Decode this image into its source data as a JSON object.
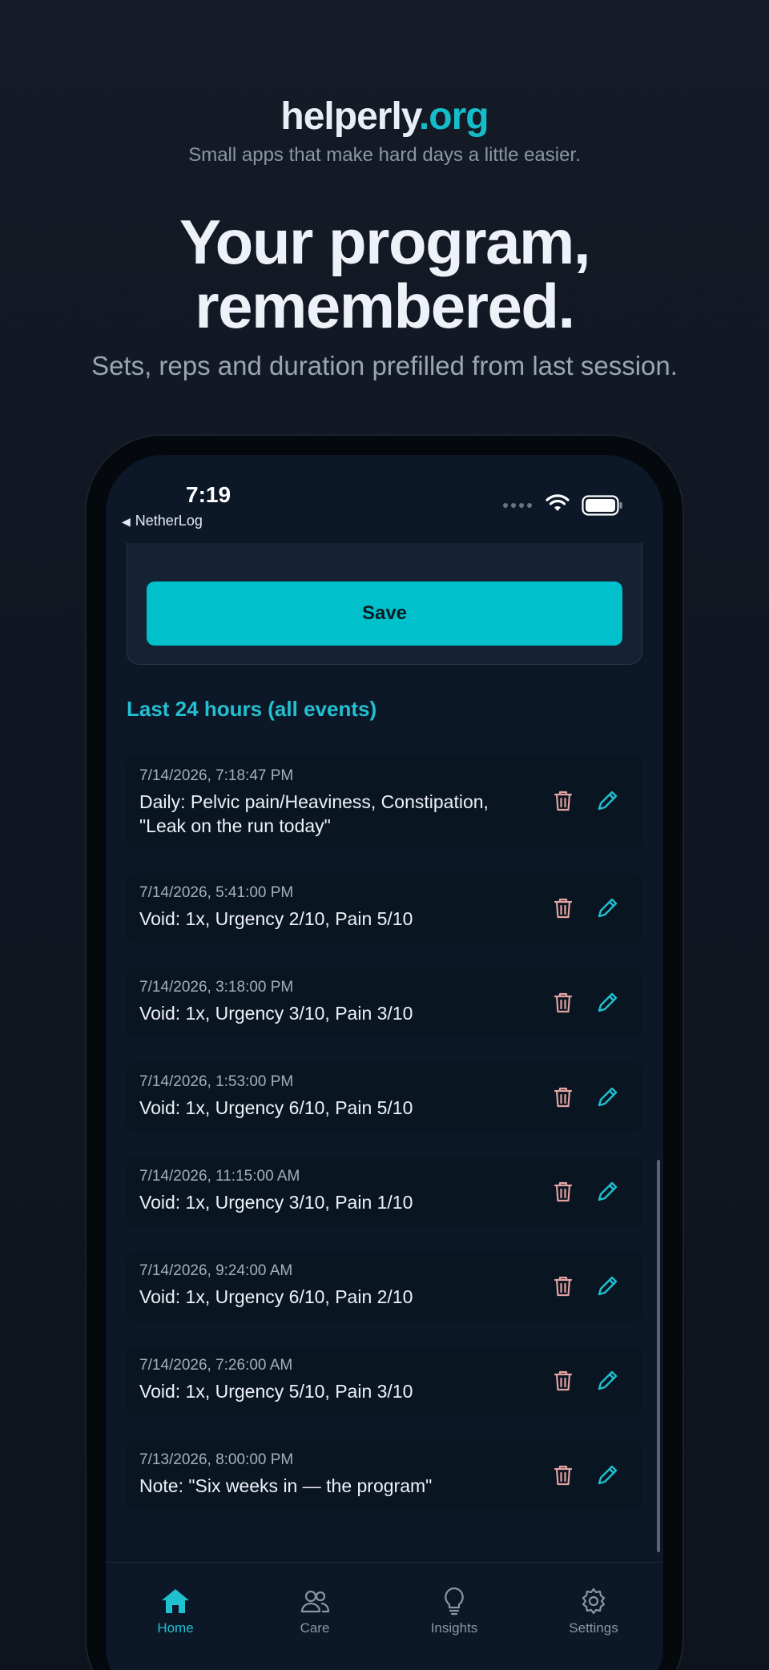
{
  "header": {
    "brand_name": "helperly",
    "brand_tld": ".org",
    "tagline": "Small apps that make hard days a little easier.",
    "hero_line1": "Your program,",
    "hero_line2": "remembered.",
    "subheading": "Sets, reps and duration prefilled from last session."
  },
  "status_bar": {
    "time": "7:19",
    "back_label": "NetherLog"
  },
  "form": {
    "save_label": "Save"
  },
  "log": {
    "section_title": "Last 24 hours (all events)",
    "entries": [
      {
        "timestamp": "7/14/2026, 7:18:47 PM",
        "text": "Daily: Pelvic pain/Heaviness, Constipation, \"Leak on the run today\""
      },
      {
        "timestamp": "7/14/2026, 5:41:00 PM",
        "text": "Void: 1x, Urgency 2/10, Pain 5/10"
      },
      {
        "timestamp": "7/14/2026, 3:18:00 PM",
        "text": "Void: 1x, Urgency 3/10, Pain 3/10"
      },
      {
        "timestamp": "7/14/2026, 1:53:00 PM",
        "text": "Void: 1x, Urgency 6/10, Pain 5/10"
      },
      {
        "timestamp": "7/14/2026, 11:15:00 AM",
        "text": "Void: 1x, Urgency 3/10, Pain 1/10"
      },
      {
        "timestamp": "7/14/2026, 9:24:00 AM",
        "text": "Void: 1x, Urgency 6/10, Pain 2/10"
      },
      {
        "timestamp": "7/14/2026, 7:26:00 AM",
        "text": "Void: 1x, Urgency 5/10, Pain 3/10"
      },
      {
        "timestamp": "7/13/2026, 8:00:00 PM",
        "text": "Note: \"Six weeks in — the program\""
      }
    ]
  },
  "tabbar": {
    "tabs": [
      {
        "label": "Home",
        "icon": "home-icon",
        "active": true
      },
      {
        "label": "Care",
        "icon": "people-icon",
        "active": false
      },
      {
        "label": "Insights",
        "icon": "lightbulb-icon",
        "active": false
      },
      {
        "label": "Settings",
        "icon": "gear-icon",
        "active": false
      }
    ]
  },
  "colors": {
    "accent": "#00c1cb",
    "delete": "#e4a3a3",
    "edit": "#1fc0cf"
  }
}
